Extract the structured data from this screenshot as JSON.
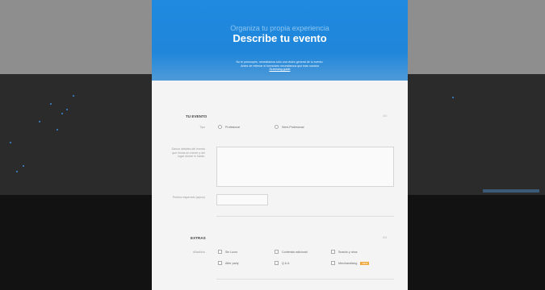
{
  "modal": {
    "supratitle": "Organiza tu propia experiencia",
    "title": "Describe tu evento",
    "intro_line1": "No te preocupes, necesitamos sólo una visión general de tu evento.",
    "intro_line2": "Antes de rellenar el formulario necesitamos que leas nuestra",
    "intro_link": "Screening guide"
  },
  "event_section": {
    "title": "TU EVENTO",
    "number": "1/4",
    "type_label": "Tipo",
    "type_options": [
      "Profesional",
      "Semi-Profesional"
    ],
    "description_label": "Danos detalles del evento que llevas en mente y del lugar donde lo harás.",
    "audience_label": "Publico esperado (aprox)",
    "audience_value": ""
  },
  "extras_section": {
    "title": "EXTRAS",
    "number": "2/4",
    "add_label": "Añadidos",
    "options": [
      "Sin Lucro",
      "Contenido adicional",
      "Snacks y otros",
      "After party",
      "Q & A",
      "Merchandising"
    ],
    "badge": "NEW"
  },
  "colors": {
    "header_blue": "#1f8ae0",
    "badge_orange": "#f0a73a"
  }
}
